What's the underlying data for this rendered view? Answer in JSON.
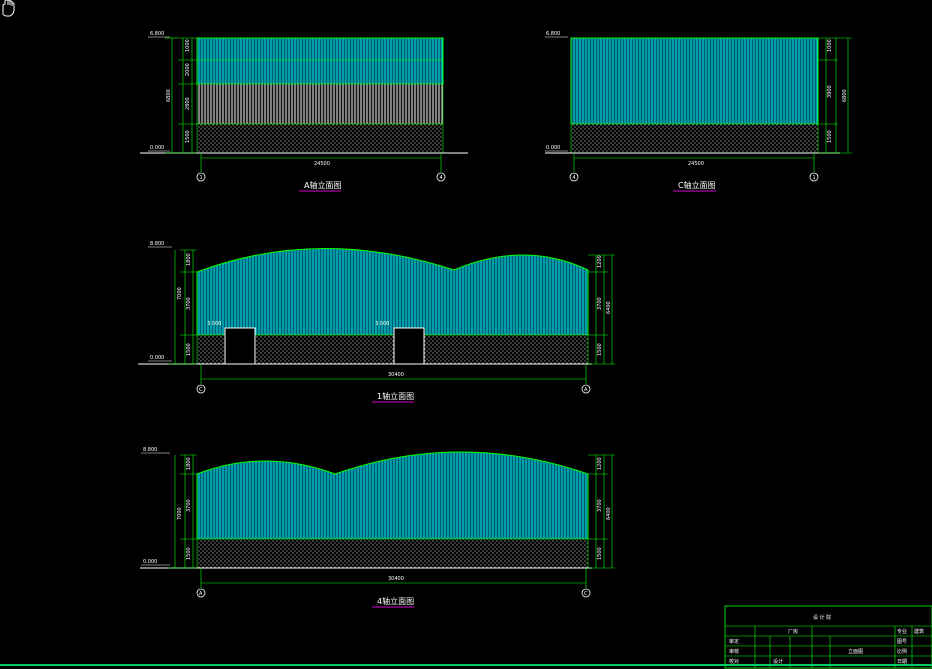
{
  "cursor": "hand-cursor",
  "colors": {
    "background": "#000000",
    "outline": "#00ff00",
    "cladding": "#00bcd4",
    "wall_base": "#ffffff",
    "underline": "#d000d0",
    "title_text": "#ffffff"
  },
  "elevations": [
    {
      "id": "elev-a",
      "title": "A轴立面图",
      "levels": [
        "6.800",
        "0.000"
      ],
      "span": "24500",
      "axes": [
        "1",
        "4"
      ],
      "left_dims": [
        "1000",
        "2000",
        "2800",
        "1500"
      ],
      "left_total": "6800"
    },
    {
      "id": "elev-c",
      "title": "C轴立面图",
      "levels": [
        "6.800",
        "0.000"
      ],
      "span": "24500",
      "axes": [
        "4",
        "1"
      ],
      "right_dims": [
        "1000",
        "3900",
        "1500"
      ],
      "right_total": "6800"
    },
    {
      "id": "elev-1",
      "title": "1轴立面图",
      "levels": [
        "8.800",
        "0.000"
      ],
      "door_levels": [
        "3.000",
        "3.000"
      ],
      "span": "30400",
      "axes": [
        "C",
        "A"
      ],
      "left_dims": [
        "1800",
        "3700",
        "1500"
      ],
      "left_total": "7000",
      "right_dims": [
        "1200",
        "3700",
        "1500"
      ],
      "right_total": "6400"
    },
    {
      "id": "elev-4",
      "title": "4轴立面图",
      "levels": [
        "8.800",
        "0.000"
      ],
      "span": "30400",
      "axes": [
        "A",
        "C"
      ],
      "left_dims": [
        "1800",
        "3700",
        "1500"
      ],
      "left_total": "7000",
      "right_dims": [
        "1200",
        "3700",
        "1500"
      ],
      "right_total": "6400"
    }
  ],
  "title_block": {
    "heading": "设 计 院",
    "project": "厂房",
    "drawing": "立面图",
    "rows": [
      "审定",
      "审核",
      "校对",
      "设计"
    ],
    "cells": [
      "专业",
      "建筑",
      "图号",
      "比例",
      "日期"
    ]
  }
}
